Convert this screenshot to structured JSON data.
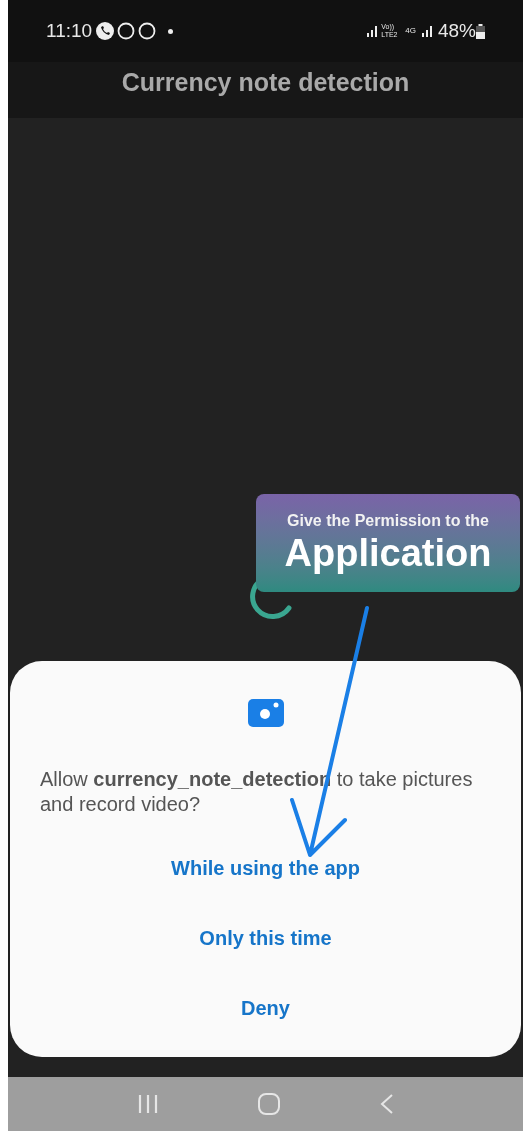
{
  "status_bar": {
    "time": "11:10",
    "network_labels": [
      "Vo)) LTE2",
      "4G"
    ],
    "battery": "48%"
  },
  "app_bar": {
    "title": "Currency note detection"
  },
  "annotation": {
    "subtitle": "Give the Permission to the",
    "title": "Application"
  },
  "dialog": {
    "message": "Allow **currency_note_detection** to take pictures and record video?",
    "buttons": [
      "While using the app",
      "Only this time",
      "Deny"
    ]
  }
}
